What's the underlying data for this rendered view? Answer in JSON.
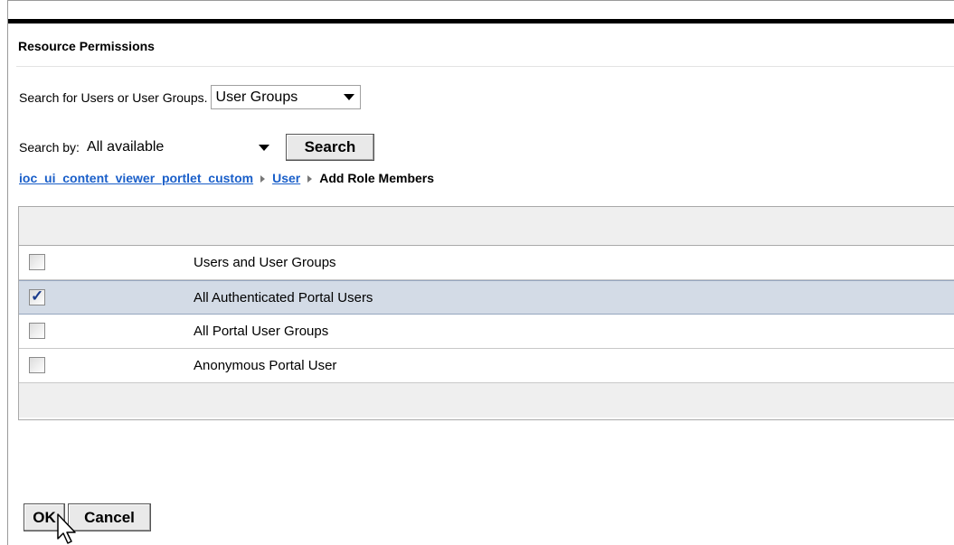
{
  "title": "Resource Permissions",
  "search_for": {
    "label": "Search for Users or User Groups.",
    "selected": "User Groups"
  },
  "search_by": {
    "label": "Search by:",
    "selected": "All available",
    "button": "Search"
  },
  "breadcrumb": {
    "items": [
      "ioc_ui_content_viewer_portlet_custom",
      "User"
    ],
    "current": "Add Role Members"
  },
  "table": {
    "rows": [
      {
        "label": "Users and User Groups",
        "checked": false
      },
      {
        "label": "All Authenticated Portal Users",
        "checked": true
      },
      {
        "label": "All Portal User Groups",
        "checked": false
      },
      {
        "label": "Anonymous Portal User",
        "checked": false
      }
    ],
    "checkmark": "✓"
  },
  "actions": {
    "ok": "OK",
    "cancel": "Cancel"
  },
  "colors": {
    "link": "#1a5fc9",
    "selected_row": "#d3dbe6"
  }
}
